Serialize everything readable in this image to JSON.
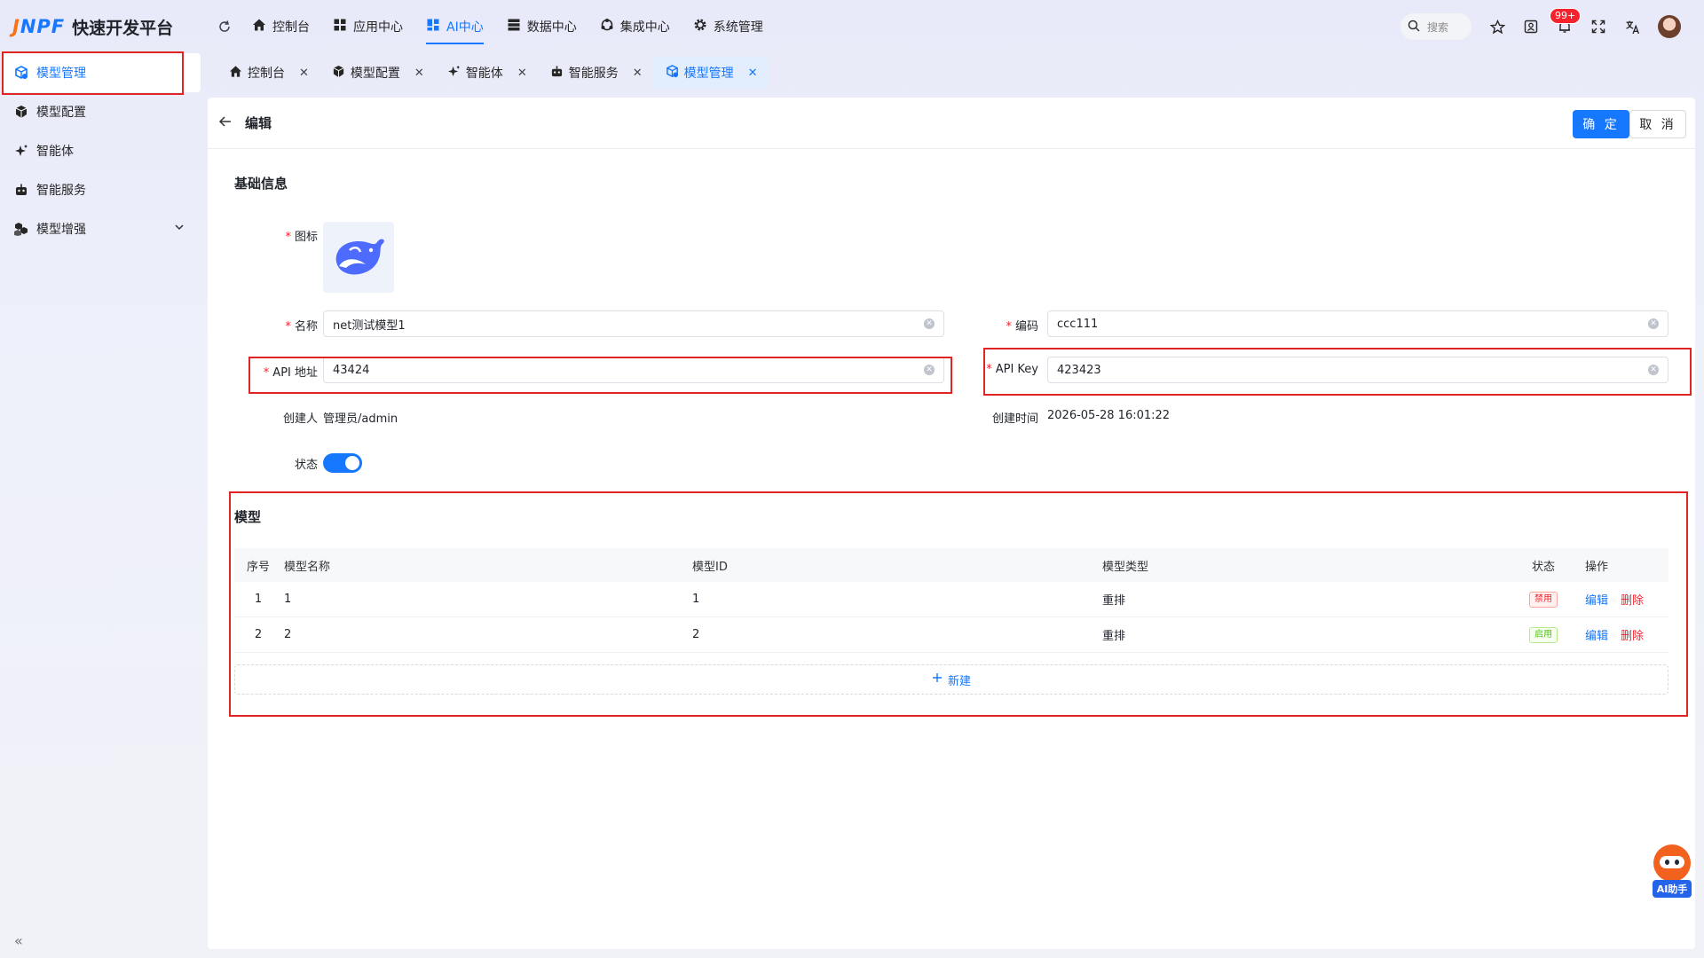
{
  "app": {
    "logo_mark_j": "J",
    "logo_mark_rest": "NPF",
    "title": "快速开发平台"
  },
  "sidebar": {
    "items": [
      {
        "label": "模型管理",
        "icon": "model-cube-icon"
      },
      {
        "label": "模型配置",
        "icon": "cube-icon"
      },
      {
        "label": "智能体",
        "icon": "sparkle-icon"
      },
      {
        "label": "智能服务",
        "icon": "robot-icon"
      },
      {
        "label": "模型增强",
        "icon": "cubes-icon"
      }
    ],
    "collapse_glyph": "«"
  },
  "topnav": {
    "items": [
      {
        "label": "控制台"
      },
      {
        "label": "应用中心"
      },
      {
        "label": "AI中心"
      },
      {
        "label": "数据中心"
      },
      {
        "label": "集成中心"
      },
      {
        "label": "系统管理"
      }
    ],
    "active_index": 2,
    "search_placeholder": "搜索",
    "notification_badge": "99+"
  },
  "tabs": [
    {
      "label": "控制台"
    },
    {
      "label": "模型配置"
    },
    {
      "label": "智能体"
    },
    {
      "label": "智能服务"
    },
    {
      "label": "模型管理"
    }
  ],
  "page": {
    "title": "编辑",
    "confirm_label": "确 定",
    "cancel_label": "取 消"
  },
  "form": {
    "section_title": "基础信息",
    "icon_label": "图标",
    "name_label": "名称",
    "name_value": "net测试模型1",
    "code_label": "编码",
    "code_value": "ccc111",
    "api_url_label": "API 地址",
    "api_url_value": "43424",
    "api_key_label": "API Key",
    "api_key_value": "423423",
    "creator_label": "创建人",
    "creator_value": "管理员/admin",
    "created_time_label": "创建时间",
    "created_time_value": "2026-05-28 16:01:22",
    "status_label": "状态",
    "status_enabled": true
  },
  "models": {
    "section_title": "模型",
    "columns": [
      "序号",
      "模型名称",
      "模型ID",
      "模型类型",
      "状态",
      "操作"
    ],
    "rows": [
      {
        "idx": "1",
        "name": "1",
        "id": "1",
        "type": "重排",
        "status": "禁用",
        "edit": "编辑",
        "delete": "删除"
      },
      {
        "idx": "2",
        "name": "2",
        "id": "2",
        "type": "重排",
        "status": "启用",
        "edit": "编辑",
        "delete": "删除"
      }
    ],
    "add_label": "新建"
  },
  "assistant": {
    "label": "AI助手"
  },
  "colors": {
    "primary": "#1677ff",
    "danger": "#f5222d",
    "success": "#52c41a",
    "highlight_box": "#e02424"
  }
}
